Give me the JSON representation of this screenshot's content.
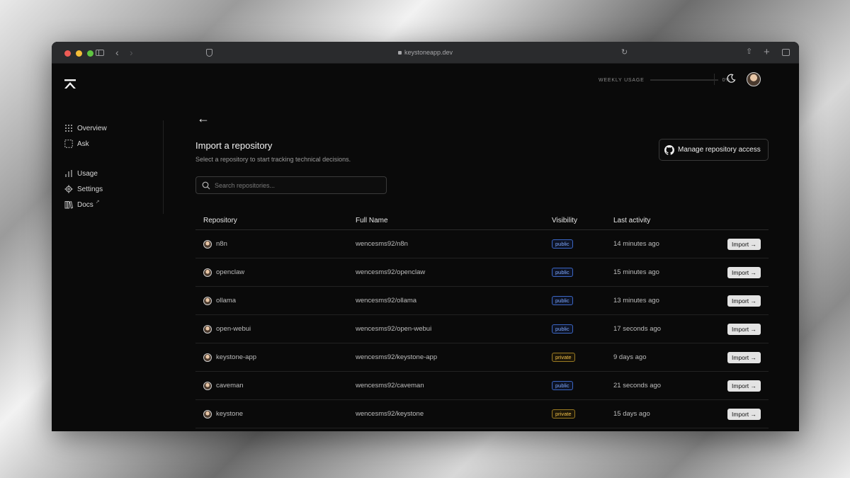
{
  "browser": {
    "url": "keystoneapp.dev"
  },
  "header": {
    "usage_label": "WEEKLY USAGE",
    "usage_value": "0%",
    "usage_fraction": 0
  },
  "sidebar": {
    "items": [
      {
        "label": "Overview",
        "icon": "grid-icon"
      },
      {
        "label": "Ask",
        "icon": "dashed-square-icon"
      },
      {
        "label": "Usage",
        "icon": "bar-chart-icon"
      },
      {
        "label": "Settings",
        "icon": "gear-icon"
      },
      {
        "label": "Docs",
        "icon": "books-icon",
        "external": "↗"
      }
    ]
  },
  "main": {
    "back_arrow": "←",
    "title": "Import a repository",
    "subtitle": "Select a repository to start tracking technical decisions.",
    "manage_label": "Manage repository access",
    "search_placeholder": "Search repositories...",
    "columns": [
      "Repository",
      "Full Name",
      "Visibility",
      "Last activity"
    ],
    "import_label": "Import →",
    "rows": [
      {
        "name": "n8n",
        "full": "wencesms92/n8n",
        "visibility": "public",
        "activity": "14 minutes ago"
      },
      {
        "name": "openclaw",
        "full": "wencesms92/openclaw",
        "visibility": "public",
        "activity": "15 minutes ago"
      },
      {
        "name": "ollama",
        "full": "wencesms92/ollama",
        "visibility": "public",
        "activity": "13 minutes ago"
      },
      {
        "name": "open-webui",
        "full": "wencesms92/open-webui",
        "visibility": "public",
        "activity": "17 seconds ago"
      },
      {
        "name": "keystone-app",
        "full": "wencesms92/keystone-app",
        "visibility": "private",
        "activity": "9 days ago"
      },
      {
        "name": "caveman",
        "full": "wencesms92/caveman",
        "visibility": "public",
        "activity": "21 seconds ago"
      },
      {
        "name": "keystone",
        "full": "wencesms92/keystone",
        "visibility": "private",
        "activity": "15 days ago"
      }
    ]
  },
  "colors": {
    "background": "#0a0a0a",
    "public_badge": "#7da8ff",
    "private_badge": "#f1c04a"
  }
}
